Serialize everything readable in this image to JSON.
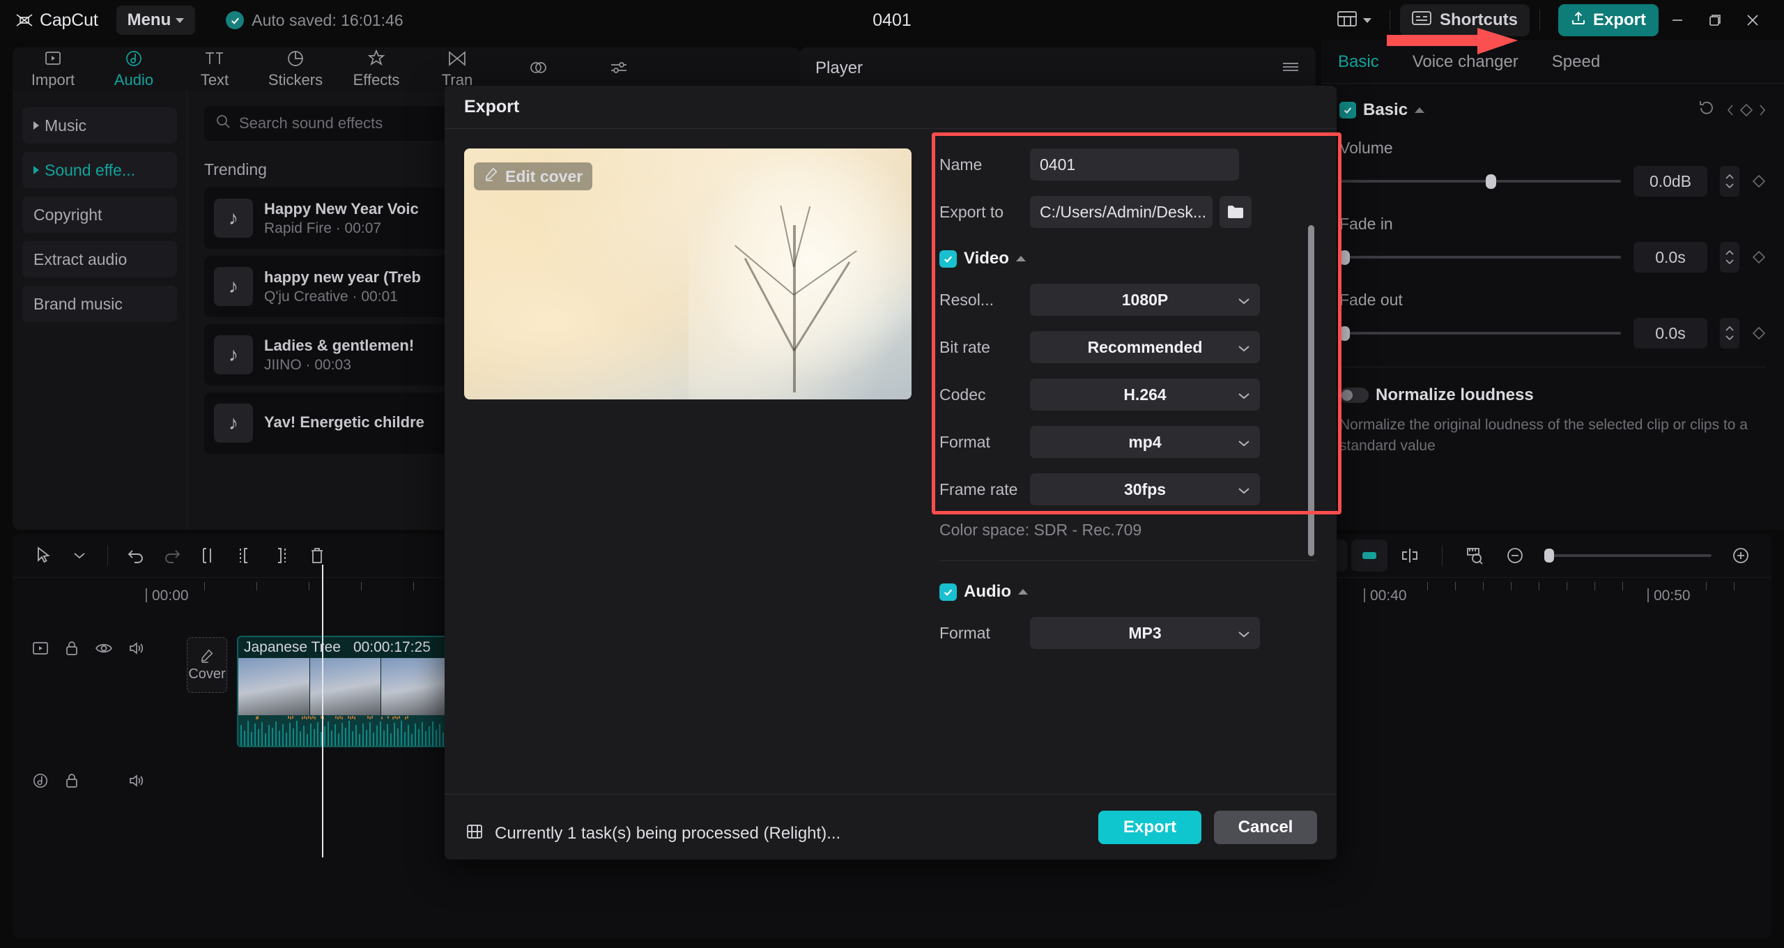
{
  "titlebar": {
    "brand": "CapCut",
    "menu_label": "Menu",
    "autosave_text": "Auto saved: 16:01:46",
    "project_title": "0401",
    "shortcuts_label": "Shortcuts",
    "export_label": "Export"
  },
  "tabs": [
    {
      "label": "Import",
      "icon": "import-icon"
    },
    {
      "label": "Audio",
      "icon": "audio-icon"
    },
    {
      "label": "Text",
      "icon": "text-icon"
    },
    {
      "label": "Stickers",
      "icon": "stickers-icon"
    },
    {
      "label": "Effects",
      "icon": "effects-icon"
    },
    {
      "label": "Tran",
      "icon": "transitions-icon"
    },
    {
      "label": "",
      "icon": "filters-icon"
    },
    {
      "label": "",
      "icon": "adjust-icon"
    }
  ],
  "left_panel": {
    "categories": [
      {
        "label": "Music",
        "expandable": true,
        "active": false
      },
      {
        "label": "Sound effe...",
        "expandable": true,
        "active": true
      },
      {
        "label": "Copyright",
        "expandable": false,
        "active": false
      },
      {
        "label": "Extract audio",
        "expandable": false,
        "active": false
      },
      {
        "label": "Brand music",
        "expandable": false,
        "active": false
      }
    ],
    "search_placeholder": "Search sound effects",
    "section_title": "Trending",
    "sound_effects": [
      {
        "name": "Happy New Year Voic",
        "meta": "Rapid Fire · 00:07"
      },
      {
        "name": "happy new year (Treb",
        "meta": "Q'ju Creative · 00:01"
      },
      {
        "name": "Ladies & gentlemen!",
        "meta": "JIINO · 00:03"
      },
      {
        "name": "Yav! Energetic childre",
        "meta": ""
      }
    ]
  },
  "player": {
    "title": "Player"
  },
  "right_panel": {
    "tabs": [
      {
        "label": "Basic",
        "active": true
      },
      {
        "label": "Voice changer",
        "active": false
      },
      {
        "label": "Speed",
        "active": false
      }
    ],
    "section_title": "Basic",
    "volume_label": "Volume",
    "volume_value": "0.0dB",
    "fade_in_label": "Fade in",
    "fade_in_value": "0.0s",
    "fade_out_label": "Fade out",
    "fade_out_value": "0.0s",
    "normalize_label": "Normalize loudness",
    "normalize_desc": "Normalize the original loudness of the selected clip or clips to a standard value"
  },
  "timeline": {
    "ruler_labels": [
      "00:00",
      "00:40",
      "00:50"
    ],
    "cover_label": "Cover",
    "clip_name": "Japanese Tree",
    "clip_duration": "00:00:17:25"
  },
  "export_dialog": {
    "title": "Export",
    "edit_cover_label": "Edit cover",
    "name_label": "Name",
    "name_value": "0401",
    "export_to_label": "Export to",
    "export_to_value": "C:/Users/Admin/Desk...",
    "video_section": "Video",
    "video_fields": [
      {
        "label": "Resol...",
        "value": "1080P"
      },
      {
        "label": "Bit rate",
        "value": "Recommended"
      },
      {
        "label": "Codec",
        "value": "H.264"
      },
      {
        "label": "Format",
        "value": "mp4"
      },
      {
        "label": "Frame rate",
        "value": "30fps"
      }
    ],
    "color_space": "Color space: SDR - Rec.709",
    "audio_section": "Audio",
    "audio_fields": [
      {
        "label": "Format",
        "value": "MP3"
      }
    ],
    "export_button": "Export",
    "cancel_button": "Cancel"
  },
  "status": {
    "task_text": "Currently 1 task(s) being processed (Relight)..."
  },
  "colors": {
    "accent_teal": "#0fc6cf",
    "brand_teal": "#12a39c",
    "highlight_red": "#ff4d4d"
  }
}
